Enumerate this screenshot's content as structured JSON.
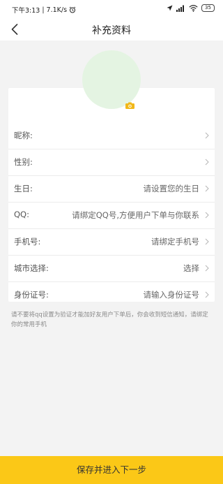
{
  "status_bar": {
    "time": "下午3:13",
    "network_speed": "7.1K/s",
    "battery_level": "35",
    "icons": [
      "alarm-icon",
      "location-icon",
      "signal-icon",
      "wifi-icon",
      "battery-icon"
    ]
  },
  "nav": {
    "back_icon": "chevron-left-icon",
    "title": "补充资料"
  },
  "avatar": {
    "camera_icon": "camera-icon",
    "placeholder_color": "#e4f4e2"
  },
  "form": {
    "rows": [
      {
        "label": "昵称:",
        "value": ""
      },
      {
        "label": "性别:",
        "value": ""
      },
      {
        "label": "生日:",
        "value": "请设置您的生日"
      },
      {
        "label": "QQ:",
        "value": "请绑定QQ号,方便用户下单与你联系"
      },
      {
        "label": "手机号:",
        "value": "请绑定手机号"
      },
      {
        "label": "城市选择:",
        "value": "选择"
      },
      {
        "label": "身份证号:",
        "value": "请输入身份证号"
      }
    ],
    "row_arrow_icon": "chevron-right-icon"
  },
  "notice": "请不要将qq设置为验证才能加好友用户下单后，你会收到短信通知，请绑定你的常用手机",
  "submit_button": "保存并进入下一步",
  "colors": {
    "accent": "#fbc817",
    "background": "#f3f3f3"
  }
}
